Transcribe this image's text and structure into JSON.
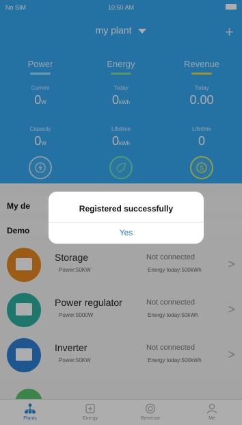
{
  "status_bar": {
    "carrier": "No SIM",
    "time": "10:50 AM"
  },
  "header": {
    "title": "my plant",
    "add_icon": "plus-icon",
    "tabs": [
      {
        "label": "Power",
        "accent": "#9fe6ff"
      },
      {
        "label": "Energy",
        "accent": "#7ee28f"
      },
      {
        "label": "Revenue",
        "accent": "#e7d64a"
      }
    ],
    "metrics_row1": [
      {
        "label": "Current",
        "value": "0",
        "unit": "W"
      },
      {
        "label": "Today",
        "value": "0",
        "unit": "kWh"
      },
      {
        "label": "Today",
        "value": "0.00",
        "unit": ""
      }
    ],
    "metrics_row2": [
      {
        "label": "Capacity",
        "value": "0",
        "unit": "W"
      },
      {
        "label": "Lifetime",
        "value": "0",
        "unit": "kWh"
      },
      {
        "label": "Lifetime",
        "value": "0",
        "unit": ""
      }
    ]
  },
  "sections": {
    "my_devices": "My de",
    "demo": "Demo"
  },
  "devices": [
    {
      "name": "Storage",
      "power": "Power:50KW",
      "status": "Not connected",
      "energy": "Energy today:500kWh",
      "color": "#e58a1f"
    },
    {
      "name": "Power regulator",
      "power": "Power:5000W",
      "status": "Not connected",
      "energy": "Energy today:50kWh",
      "color": "#2bb0a1"
    },
    {
      "name": "Inverter",
      "power": "Power:50KW",
      "status": "Not connected",
      "energy": "Energy today:500kWh",
      "color": "#2d7fd3"
    }
  ],
  "nav": [
    "Plants",
    "Energy",
    "Revenue",
    "Me"
  ],
  "dialog": {
    "message": "Registered successfully",
    "button": "Yes"
  },
  "colors": {
    "header_bg": "#36a9f0",
    "accent_blue": "#2a8bd1"
  }
}
